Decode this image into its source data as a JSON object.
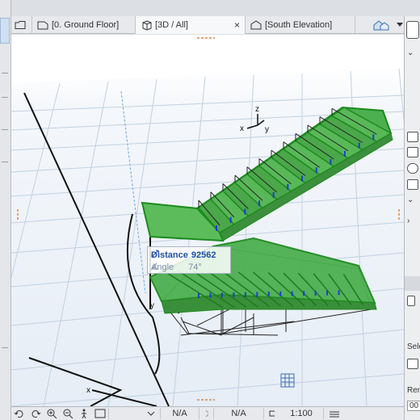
{
  "tabs": [
    {
      "label": "[0. Ground Floor]",
      "icon": "floor-plan-icon"
    },
    {
      "label": "[3D / All]",
      "icon": "3d-view-icon",
      "active": true
    },
    {
      "label": "[South Elevation]",
      "icon": "elevation-icon"
    }
  ],
  "tab_close": "×",
  "tracker": {
    "distance_label": "Distance",
    "distance_value": "92562",
    "angle_label": "Angle",
    "angle_value": "74°"
  },
  "axes": {
    "x": "x",
    "y": "y",
    "z": "z"
  },
  "statusbar": {
    "na1": "N/A",
    "na2": "N/A",
    "scale": "1:100"
  },
  "right_panel": {
    "sel_label": "Sele",
    "ren_label": "Ren",
    "ren_value": "00"
  },
  "colors": {
    "stair_green": "#2fb52f",
    "stair_fill": "#4caf50",
    "grid": "#b8c7da",
    "accent_blue": "#1f4fa6"
  }
}
